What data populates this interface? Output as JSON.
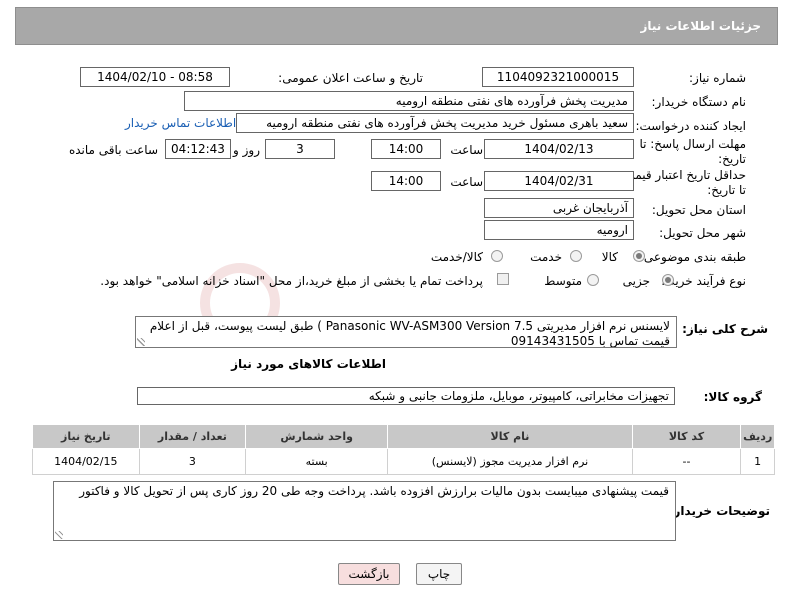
{
  "header": {
    "title": "جزئیات اطلاعات نیاز"
  },
  "fields": {
    "need_number_label": "شماره نیاز:",
    "need_number": "1104092321000015",
    "announce_label": "تاریخ و ساعت اعلان عمومی:",
    "announce_value": "1404/02/10 - 08:58",
    "buyer_org_label": "نام دستگاه خریدار:",
    "buyer_org": "مدیریت پخش فرآورده های نفتی منطقه ارومیه",
    "requester_label": "ایجاد کننده درخواست:",
    "requester": "سعید باهری مسئول خرید مدیریت پخش فرآورده های نفتی منطقه ارومیه",
    "buyer_contact_link": "اطلاعات تماس خریدار",
    "reply_deadline_label": "مهلت ارسال پاسخ: تا تاریخ:",
    "reply_date": "1404/02/13",
    "time_label": "ساعت",
    "reply_time": "14:00",
    "reply_days": "3",
    "days_and_label": "روز و",
    "remaining_time": "04:12:43",
    "remaining_label": "ساعت باقی مانده",
    "price_validity_label": "حداقل تاریخ اعتبار قیمت تا تاریخ:",
    "validity_date": "1404/02/31",
    "validity_time": "14:00",
    "province_label": "استان محل تحویل:",
    "province": "آذربایجان غربی",
    "city_label": "شهر محل تحویل:",
    "city": "ارومیه",
    "category_label": "طبقه بندی موضوعی:",
    "category_options": [
      "کالا",
      "خدمت",
      "کالا/خدمت"
    ],
    "process_label": "نوع فرآیند خرید :",
    "process_options": [
      "جزیی",
      "متوسط"
    ],
    "process_note": "پرداخت تمام یا بخشی از مبلغ خرید،از محل \"اسناد خزانه اسلامی\" خواهد بود."
  },
  "description": {
    "label": "شرح کلی نیاز:",
    "text": "لایسنس نرم افزار مدیریتی  Panasonic WV-ASM300 Version 7.5 )  طبق لیست پیوست، قبل از اعلام قیمت تماس با 09143431505"
  },
  "goods_section": {
    "title": "اطلاعات کالاهای مورد نیاز",
    "group_label": "گروه کالا:",
    "group_value": "تجهیزات مخابراتی، کامپیوتر، موبایل، ملزومات جانبی و شبکه"
  },
  "table": {
    "headers": [
      "ردیف",
      "کد کالا",
      "نام کالا",
      "واحد شمارش",
      "تعداد / مقدار",
      "تاریخ نیاز"
    ],
    "rows": [
      [
        "1",
        "--",
        "نرم افزار مدیریت مجوز (لایسنس)",
        "بسته",
        "3",
        "1404/02/15"
      ]
    ]
  },
  "buyer_notes": {
    "label": "توضیحات خریدار:",
    "text": "قیمت پیشنهادی میبایست بدون مالیات برارزش افزوده باشد. پرداخت وجه طی 20 روز کاری پس از تحویل کالا و فاکتور"
  },
  "buttons": {
    "print": "چاپ",
    "back": "بازگشت"
  },
  "colors": {
    "header_bg": "#a8a8a8",
    "link": "#1a5fb4",
    "back_button_bg": "#f7dede"
  }
}
